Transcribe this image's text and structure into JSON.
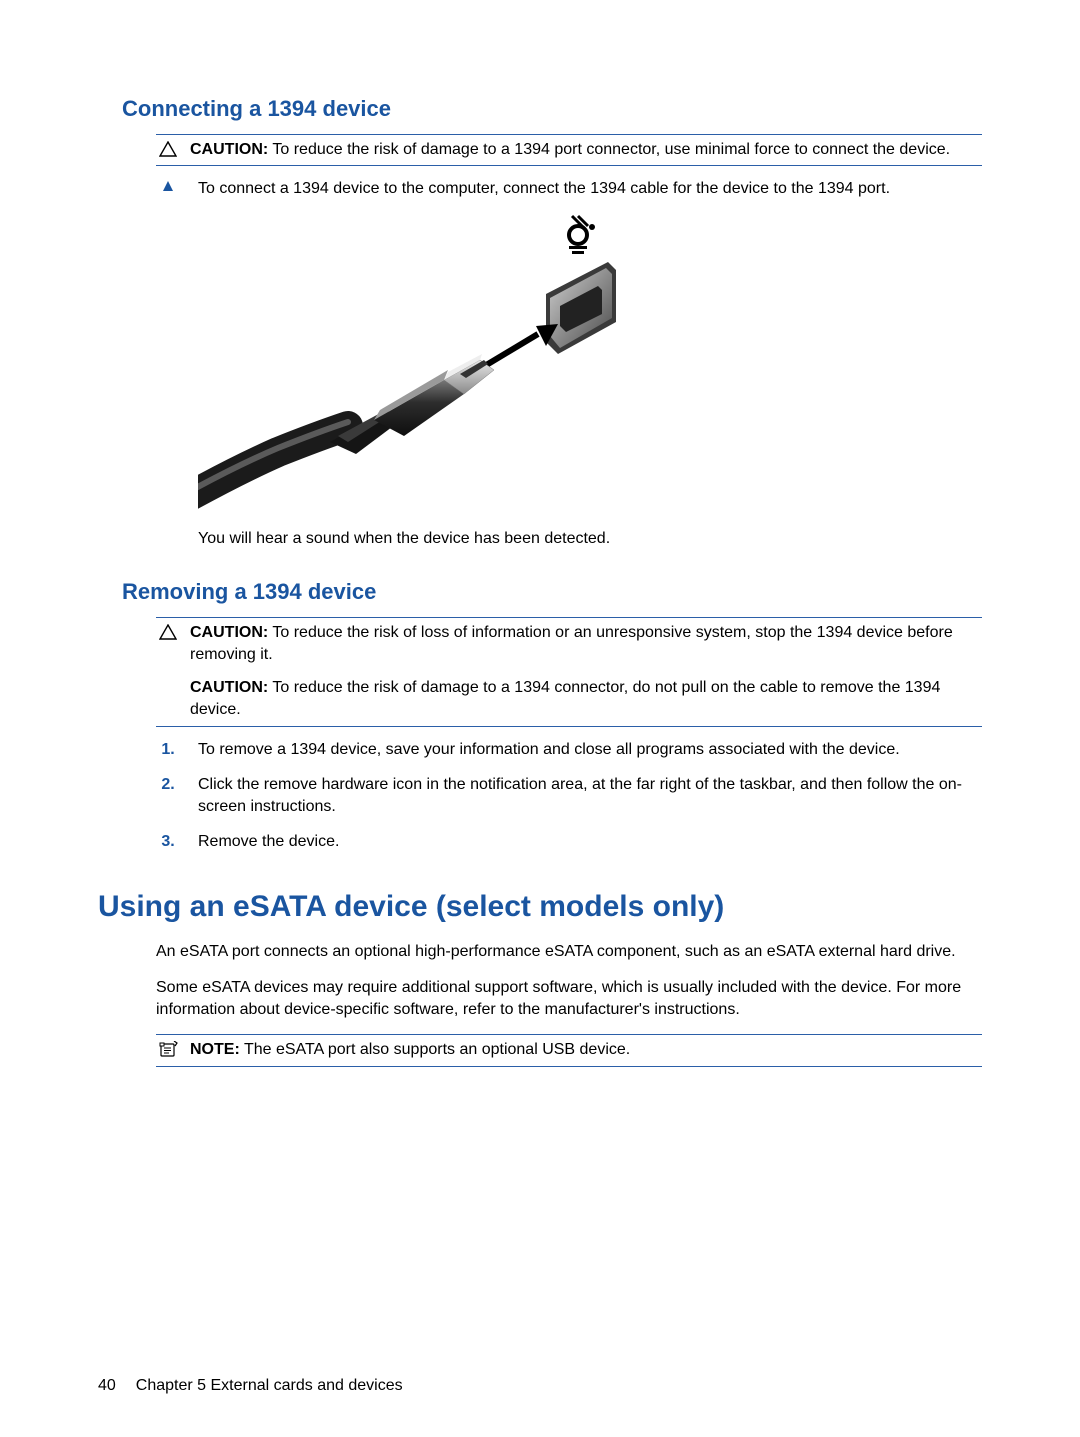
{
  "section1": {
    "heading": "Connecting a 1394 device",
    "caution": {
      "label": "CAUTION:",
      "text": "To reduce the risk of damage to a 1394 port connector, use minimal force to connect the device."
    },
    "step1": "To connect a 1394 device to the computer, connect the 1394 cable for the device to the 1394 port.",
    "after_figure": "You will hear a sound when the device has been detected."
  },
  "section2": {
    "heading": "Removing a 1394 device",
    "caution1": {
      "label": "CAUTION:",
      "text": "To reduce the risk of loss of information or an unresponsive system, stop the 1394 device before removing it."
    },
    "caution2": {
      "label": "CAUTION:",
      "text": "To reduce the risk of damage to a 1394 connector, do not pull on the cable to remove the 1394 device."
    },
    "steps": {
      "n1": "1.",
      "t1": "To remove a 1394 device, save your information and close all programs associated with the device.",
      "n2": "2.",
      "t2": "Click the remove hardware icon in the notification area, at the far right of the taskbar, and then follow the on-screen instructions.",
      "n3": "3.",
      "t3": "Remove the device."
    }
  },
  "section3": {
    "heading": "Using an eSATA device (select models only)",
    "para1": "An eSATA port connects an optional high-performance eSATA component, such as an eSATA external hard drive.",
    "para2": "Some eSATA devices may require additional support software, which is usually included with the device. For more information about device-specific software, refer to the manufacturer's instructions.",
    "note": {
      "label": "NOTE:",
      "text": "The eSATA port also supports an optional USB device."
    }
  },
  "footer": {
    "page": "40",
    "chapter": "Chapter 5   External cards and devices"
  }
}
